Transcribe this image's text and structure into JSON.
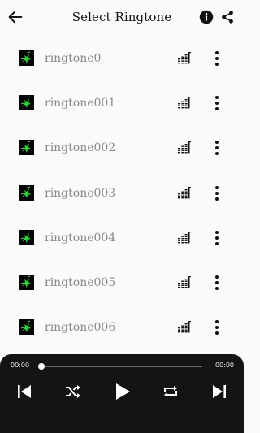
{
  "app_bar": {
    "title": "Select Ringtone",
    "back_icon": "arrow-left-icon",
    "info_icon": "info-icon",
    "share_icon": "share-icon"
  },
  "ringtones": [
    {
      "name": "ringtone0"
    },
    {
      "name": "ringtone001"
    },
    {
      "name": "ringtone002"
    },
    {
      "name": "ringtone003"
    },
    {
      "name": "ringtone004"
    },
    {
      "name": "ringtone005"
    },
    {
      "name": "ringtone006"
    }
  ],
  "row_icons": {
    "thumbnail": "ringtone-thumbnail-icon",
    "equalizer": "equalizer-icon",
    "menu": "more-vertical-icon"
  },
  "player": {
    "current_time": "00:00",
    "total_time": "00:00",
    "progress": 0,
    "controls": [
      "skip-previous-icon",
      "shuffle-icon",
      "play-icon",
      "repeat-icon",
      "skip-next-icon"
    ]
  },
  "colors": {
    "background": "#fafafa",
    "player_background": "#141414",
    "ringtone_name": "#8a8a8a",
    "thumbnail_accent": "#2fd03b"
  }
}
